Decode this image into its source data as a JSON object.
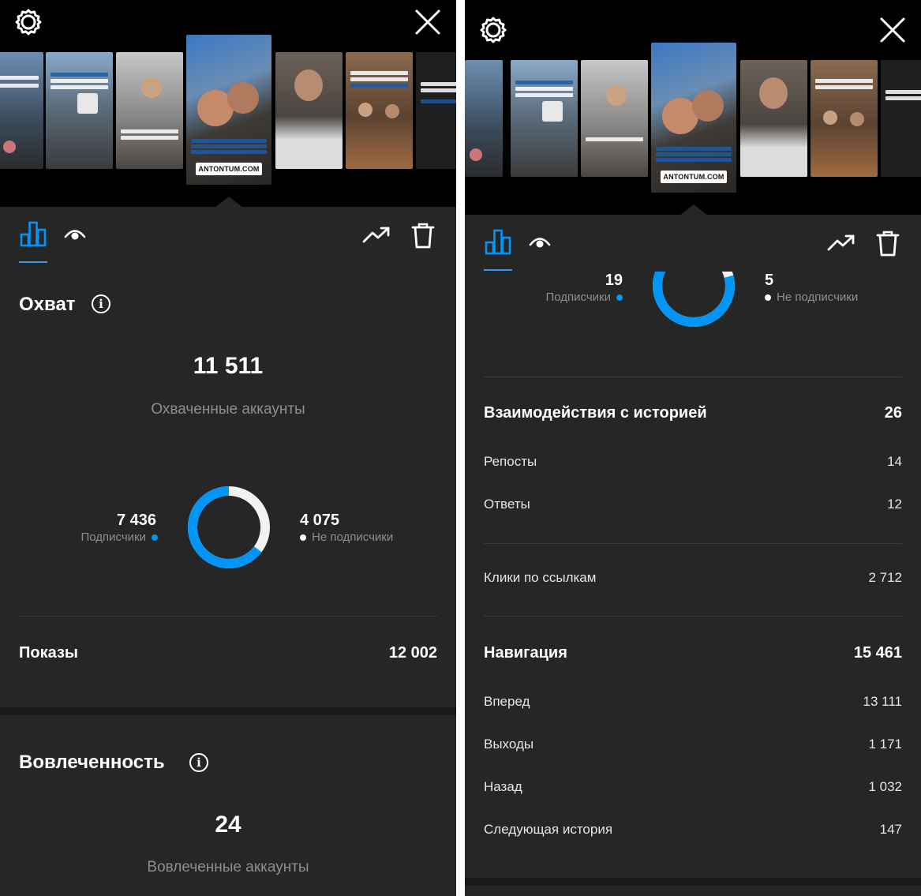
{
  "thumbnails": {
    "link_badge": "ANTONTUM.COM"
  },
  "left": {
    "reach": {
      "title": "Охват",
      "accounts_reached": "11 511",
      "accounts_reached_label": "Охваченные аккаунты",
      "followers_value": "7 436",
      "followers_label": "Подписчики",
      "non_followers_value": "4 075",
      "non_followers_label": "Не подписчики",
      "followers_fraction": 0.646
    },
    "impressions": {
      "label": "Показы",
      "value": "12 002"
    },
    "engagement": {
      "title": "Вовлеченность",
      "accounts_engaged": "24",
      "accounts_engaged_label": "Вовлеченные аккаунты"
    }
  },
  "right": {
    "donut": {
      "followers_value": "19",
      "followers_label": "Подписчики",
      "non_followers_value": "5",
      "non_followers_label": "Не подписчики",
      "followers_fraction": 0.79
    },
    "interactions": {
      "title": "Взаимодействия с историей",
      "total": "26",
      "rows": [
        {
          "label": "Репосты",
          "value": "14"
        },
        {
          "label": "Ответы",
          "value": "12"
        }
      ]
    },
    "link_clicks": {
      "label": "Клики по ссылкам",
      "value": "2 712"
    },
    "navigation": {
      "title": "Навигация",
      "total": "15 461",
      "rows": [
        {
          "label": "Вперед",
          "value": "13 111"
        },
        {
          "label": "Выходы",
          "value": "1 171"
        },
        {
          "label": "Назад",
          "value": "1 032"
        },
        {
          "label": "Следующая история",
          "value": "147"
        }
      ]
    }
  },
  "icons": {
    "settings": "gear-icon",
    "close": "close-icon",
    "insights_tab": "bar-chart-icon",
    "viewers_tab": "eye-icon",
    "promote": "trending-up-icon",
    "delete": "trash-icon",
    "info": "info-icon"
  },
  "colors": {
    "accent": "#0095f6",
    "sheet_bg": "#262626",
    "muted_text": "#8e8e8e"
  }
}
